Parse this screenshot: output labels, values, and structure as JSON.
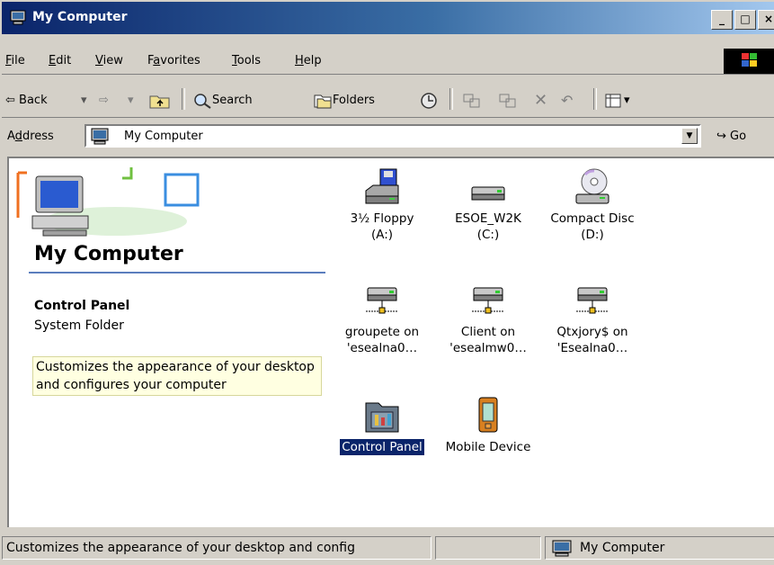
{
  "window": {
    "title": "My Computer"
  },
  "title_buttons": {
    "minimize": "_",
    "maximize": "□",
    "close": "×"
  },
  "menu": [
    {
      "key": "F",
      "rest": "ile"
    },
    {
      "key": "E",
      "rest": "dit"
    },
    {
      "key": "V",
      "rest": "iew"
    },
    {
      "pre": "F",
      "key": "a",
      "rest": "vorites"
    },
    {
      "key": "T",
      "rest": "ools"
    },
    {
      "key": "H",
      "rest": "elp"
    }
  ],
  "toolbar": {
    "back": "Back",
    "search": "Search",
    "folders": "Folders"
  },
  "address": {
    "label_pre": "A",
    "label_key": "d",
    "label_rest": "dress",
    "value": "My Computer",
    "go": "Go"
  },
  "left_panel": {
    "title": "My Computer",
    "selected_name": "Control Panel",
    "selected_type": "System Folder",
    "selected_description": "Customizes the appearance of your desktop and configures your computer"
  },
  "items": [
    {
      "line1": "3½ Floppy",
      "line2": "(A:)",
      "icon": "floppy-drive-icon"
    },
    {
      "line1": "ESOE_W2K",
      "line2": "(C:)",
      "icon": "hard-drive-icon"
    },
    {
      "line1": "Compact Disc",
      "line2": "(D:)",
      "icon": "cd-drive-icon"
    },
    {
      "line1": "groupete on",
      "line2": "'esealna0…",
      "icon": "network-drive-icon"
    },
    {
      "line1": "Client on",
      "line2": "'esealmw0…",
      "icon": "network-drive-icon"
    },
    {
      "line1": "Qtxjory$ on",
      "line2": "'Esealna0…",
      "icon": "network-drive-icon"
    },
    {
      "line1": "Control Panel",
      "line2": "",
      "icon": "control-panel-icon",
      "selected": true
    },
    {
      "line1": "Mobile Device",
      "line2": "",
      "icon": "mobile-device-icon"
    }
  ],
  "status": {
    "text": "Customizes the appearance of your desktop and config",
    "location": "My Computer"
  },
  "colors": {
    "titlebar_start": "#0a246a",
    "titlebar_end": "#a6caf0",
    "selection": "#0a246a",
    "face": "#d4d0c8"
  }
}
